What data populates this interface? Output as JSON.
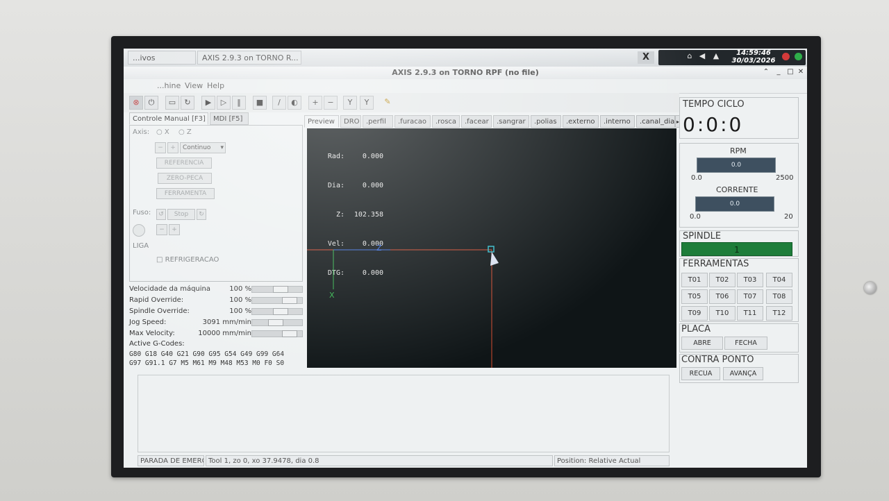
{
  "taskbar": {
    "tasks": [
      "...ivos",
      "AXIS 2.9.3 on TORNO R..."
    ],
    "tray_x": "X",
    "clock_time": "14:59:46",
    "clock_date": "30/03/2026"
  },
  "window": {
    "title": "AXIS 2.9.3 on TORNO RPF (no file)",
    "menu": [
      "...hine",
      "View",
      "Help"
    ]
  },
  "left_tabs": [
    "Controle Manual [F3]",
    "MDI [F5]"
  ],
  "manual": {
    "axis_label": "Axis:",
    "axis_x": "X",
    "axis_z": "Z",
    "jog_mode": "Continuo",
    "btn_referencia": "REFERENCIA",
    "btn_zero_peca": "ZERO-PECA",
    "btn_ferramenta": "FERRAMENTA",
    "fuso_label": "Fuso:",
    "stop_label": "Stop",
    "liga_label": "LIGA",
    "refrigeracao_label": "REFRIGERACAO"
  },
  "overrides": [
    {
      "label": "Velocidade da máquina",
      "value": "100 %",
      "level": 0.6
    },
    {
      "label": "Rapid Override:",
      "value": "100 %",
      "level": 0.85
    },
    {
      "label": "Spindle Override:",
      "value": "100 %",
      "level": 0.6
    },
    {
      "label": "Jog Speed:",
      "value": "3091 mm/min",
      "level": 0.45
    },
    {
      "label": "Max Velocity:",
      "value": "10000 mm/min",
      "level": 0.85
    }
  ],
  "gcodes": {
    "label": "Active G-Codes:",
    "line1": "G80 G18 G40 G21 G90 G95 G54 G49 G99 G64",
    "line2": "G97 G91.1 G7 M5 M61 M9 M48 M53 M0 F0 S0"
  },
  "preview_tabs": [
    "Preview",
    "DRO",
    ".perfil",
    ".furacao",
    ".rosca",
    ".facear",
    ".sangrar",
    ".polias",
    ".externo",
    ".interno",
    ".canal_dia"
  ],
  "dro": [
    {
      "label": "Rad:",
      "value": "0.000"
    },
    {
      "label": "Dia:",
      "value": "0.000"
    },
    {
      "label": "Z:",
      "value": "102.358"
    },
    {
      "label": "Vel:",
      "value": "0.000"
    },
    {
      "label": "DTG:",
      "value": "0.000"
    }
  ],
  "preview_axes": {
    "z": "Z",
    "x": "X"
  },
  "status": {
    "estop": "PARADA DE EMERG",
    "tool": "Tool 1, zo 0, xo 37.9478, dia 0.8",
    "position": "Position: Relative Actual"
  },
  "right": {
    "tempo_title": "TEMPO CICLO",
    "tempo_value": "0:0:0",
    "rpm_label": "RPM",
    "rpm_value": "0.0",
    "rpm_min": "0.0",
    "rpm_max": "2500",
    "corrente_label": "CORRENTE",
    "corrente_value": "0.0",
    "corrente_min": "0.0",
    "corrente_max": "20",
    "spindle_title": "SPINDLE",
    "spindle_value": "1",
    "ferramentas_title": "FERRAMENTAS",
    "tools": [
      "T01",
      "T02",
      "T03",
      "T04",
      "T05",
      "T06",
      "T07",
      "T08",
      "T09",
      "T10",
      "T11",
      "T12"
    ],
    "placa_title": "PLACA",
    "placa_abre": "ABRE",
    "placa_fecha": "FECHA",
    "contra_title": "CONTRA PONTO",
    "contra_recua": "RECUA",
    "contra_avanca": "AVANÇA"
  },
  "colors": {
    "spindle_active": "#1e7d3a",
    "gauge_fill": "#3e5060",
    "preview_bg": "#0f1517"
  }
}
